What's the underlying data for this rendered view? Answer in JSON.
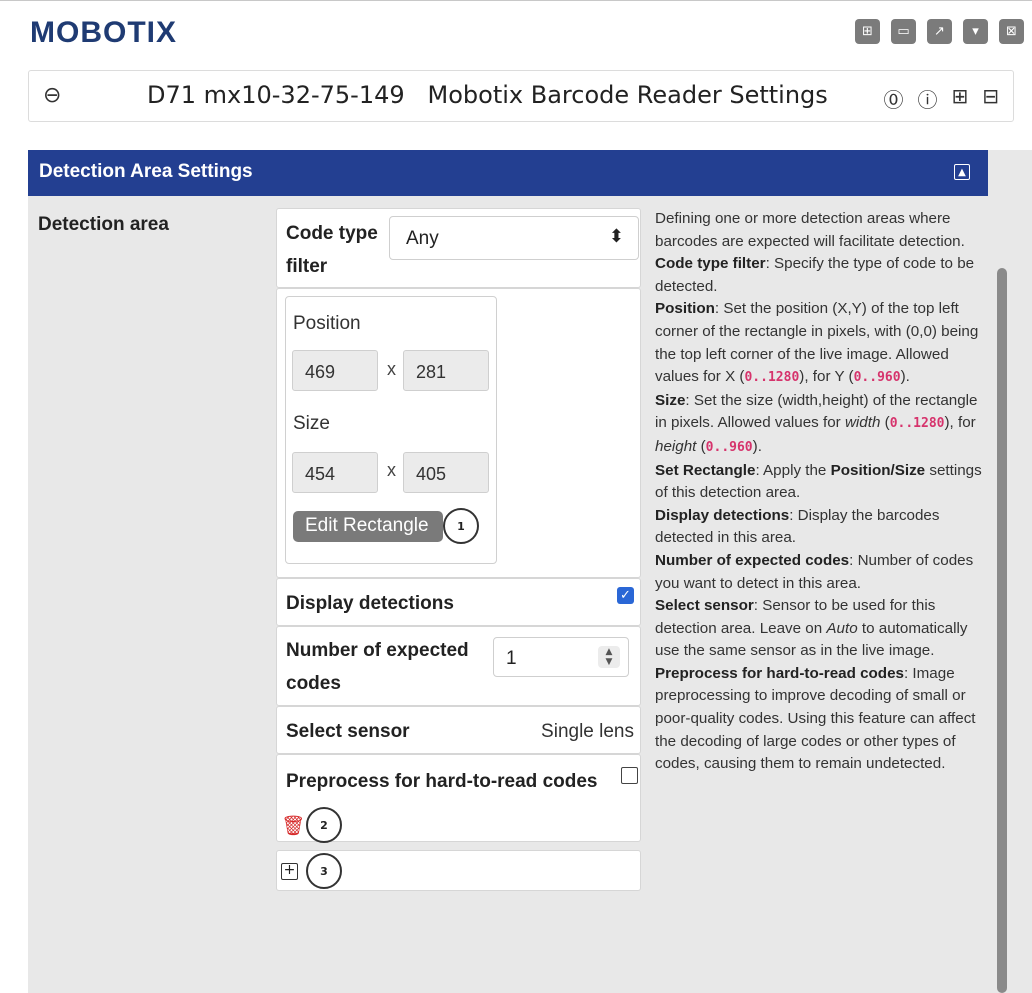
{
  "brand": {
    "logo_text": "MOBOTIX"
  },
  "window_controls": [
    {
      "name": "layout-icon",
      "glyph": "⊞"
    },
    {
      "name": "minimize-icon",
      "glyph": "▭"
    },
    {
      "name": "open-external-icon",
      "glyph": "↗"
    },
    {
      "name": "dropdown-icon",
      "glyph": "▾"
    },
    {
      "name": "close-icon",
      "glyph": "⊠"
    }
  ],
  "titlebar": {
    "camera": "D71 mx10-32-75-149",
    "title": "Mobotix Barcode Reader Settings",
    "icons": [
      "help-icon",
      "info-icon",
      "expand-all-icon",
      "collapse-all-icon"
    ]
  },
  "section": {
    "title": "Detection Area Settings",
    "row_label": "Detection area"
  },
  "form": {
    "code_type_label_1": "Code type",
    "code_type_label_2": "filter",
    "code_type_value": "Any",
    "position_label": "Position",
    "position_x": "469",
    "position_y": "281",
    "x_sep": "x",
    "size_label": "Size",
    "size_w": "454",
    "size_h": "405",
    "edit_rectangle": "Edit Rectangle",
    "callout_1": "1",
    "display_detections_label": "Display detections",
    "display_detections_checked": true,
    "expected_codes_label_1": "Number of expected",
    "expected_codes_label_2": "codes",
    "expected_codes_value": "1",
    "select_sensor_label": "Select sensor",
    "select_sensor_value": "Single lens",
    "preprocess_label": "Preprocess for hard-to-read codes",
    "preprocess_checked": false,
    "callout_2": "2",
    "callout_3": "3"
  },
  "help": {
    "intro": "Defining one or more detection areas where barcodes are expected will facilitate detection.",
    "code_type_term": "Code type filter",
    "code_type_text": ": Specify the type of code to be detected.",
    "position_term": "Position",
    "position_text_1": ": Set the position (X,Y) of the top left corner of the rectangle in pixels, with (0,0) being the top left corner of the live image. Allowed values for X (",
    "range_x": "0..1280",
    "position_text_2": "), for Y (",
    "range_y": "0..960",
    "position_text_3": ").",
    "size_term": "Size",
    "size_text_1": ": Set the size (width,height) of the rectangle in pixels. Allowed values for ",
    "width_word": "width",
    "size_text_2": " (",
    "range_w": "0..1280",
    "size_text_3": "), for ",
    "height_word": "height",
    "size_text_4": " (",
    "range_h": "0..960",
    "size_text_5": ").",
    "set_rect_term": "Set Rectangle",
    "set_rect_text_1": ": Apply the ",
    "set_rect_bold": "Position/Size",
    "set_rect_text_2": " settings of this detection area.",
    "display_term": "Display detections",
    "display_text": ": Display the barcodes detected in this area.",
    "expected_term": "Number of expected codes",
    "expected_text": ": Number of codes you want to detect in this area.",
    "sensor_term": "Select sensor",
    "sensor_text_1": ": Sensor to be used for this detection area. Leave on ",
    "sensor_auto": "Auto",
    "sensor_text_2": " to automatically use the same sensor as in the live image.",
    "preprocess_term": "Preprocess for hard-to-read codes",
    "preprocess_text": ": Image preprocessing to improve decoding of small or poor-quality codes. Using this feature can affect the decoding of large codes or other types of codes, causing them to remain undetected."
  },
  "colors": {
    "brand": "#1f3b73",
    "section_header": "#233f91",
    "checkbox": "#2a67d6",
    "delete": "#d62828",
    "code_range": "#d6336c"
  }
}
